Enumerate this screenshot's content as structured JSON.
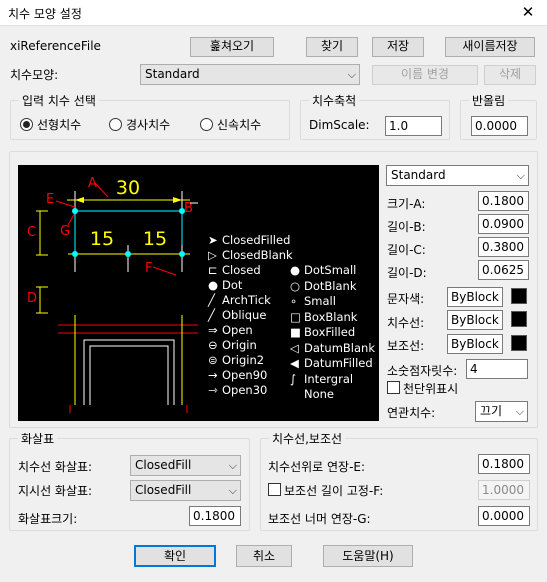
{
  "window": {
    "title": "치수 모양 설정",
    "close_icon": "close-icon"
  },
  "file": {
    "label": "xiReferenceFile",
    "browse": "훑쳐오기",
    "find": "찾기",
    "save": "저장",
    "save_as": "새이름저장"
  },
  "style": {
    "label": "치수모양:",
    "value": "Standard",
    "rename": "이름  변경",
    "delete": "삭제"
  },
  "input_select": {
    "title": "입력 치수 선택",
    "options": [
      {
        "label": "선형치수",
        "checked": true
      },
      {
        "label": "경사치수",
        "checked": false
      },
      {
        "label": "신속치수",
        "checked": false
      }
    ]
  },
  "dim_scale": {
    "title": "치수축척",
    "label": "DimScale:",
    "value": "1.0"
  },
  "rounding": {
    "title": "반올림",
    "value": "0.0000"
  },
  "preview": {
    "labels": [
      "A",
      "30",
      "B",
      "E",
      "G",
      "C",
      "15",
      "15",
      "F",
      "D"
    ],
    "arrow_names": {
      "left": [
        "ClosedFilled",
        "ClosedBlank",
        "Closed",
        "Dot",
        "ArchTick",
        "Oblique",
        "Open",
        "Origin",
        "Origin2",
        "Open90",
        "Open30"
      ],
      "right": [
        "DotSmall",
        "DotBlank",
        "Small",
        "BoxBlank",
        "BoxFilled",
        "DatumBlank",
        "DatumFilled",
        "Intergral",
        "None"
      ]
    }
  },
  "props": {
    "preset": "Standard",
    "size_a": {
      "label": "크기-A:",
      "value": "0.1800"
    },
    "len_b": {
      "label": "길이-B:",
      "value": "0.0900"
    },
    "len_c": {
      "label": "길이-C:",
      "value": "0.3800"
    },
    "len_d": {
      "label": "길이-D:",
      "value": "0.0625"
    },
    "text_color": {
      "label": "문자색:",
      "value": "ByBlock"
    },
    "dim_line": {
      "label": "치수선:",
      "value": "ByBlock"
    },
    "ext_line": {
      "label": "보조선:",
      "value": "ByBlock"
    },
    "decimals": {
      "label": "소숫점자릿수:",
      "value": "4"
    },
    "thousands": {
      "label": "천단위표시"
    },
    "assoc": {
      "label": "연관치수:",
      "value": "끄기"
    }
  },
  "arrows": {
    "title": "화살표",
    "dim_arrow": {
      "label": "치수선 화살표:",
      "value": "ClosedFill"
    },
    "leader_arrow": {
      "label": "지시선 화살표:",
      "value": "ClosedFill"
    },
    "size": {
      "label": "화살표크기:",
      "value": "0.1800"
    }
  },
  "lines": {
    "title": "치수선,보조선",
    "extend_above": {
      "label": "치수선위로 연장-E:",
      "value": "0.1800"
    },
    "fixed_length": {
      "label": "보조선 길이 고정-F:",
      "value": "1.0000"
    },
    "extend_beyond": {
      "label": "보조선 너머 연장-G:",
      "value": "0.0000"
    }
  },
  "footer": {
    "ok": "확인",
    "cancel": "취소",
    "help": "도움말(H)"
  },
  "colors": {
    "yellow": "#ffff00",
    "cyan": "#00ffff",
    "red": "#ff0000",
    "green": "#00ff00",
    "white": "#ffffff"
  }
}
